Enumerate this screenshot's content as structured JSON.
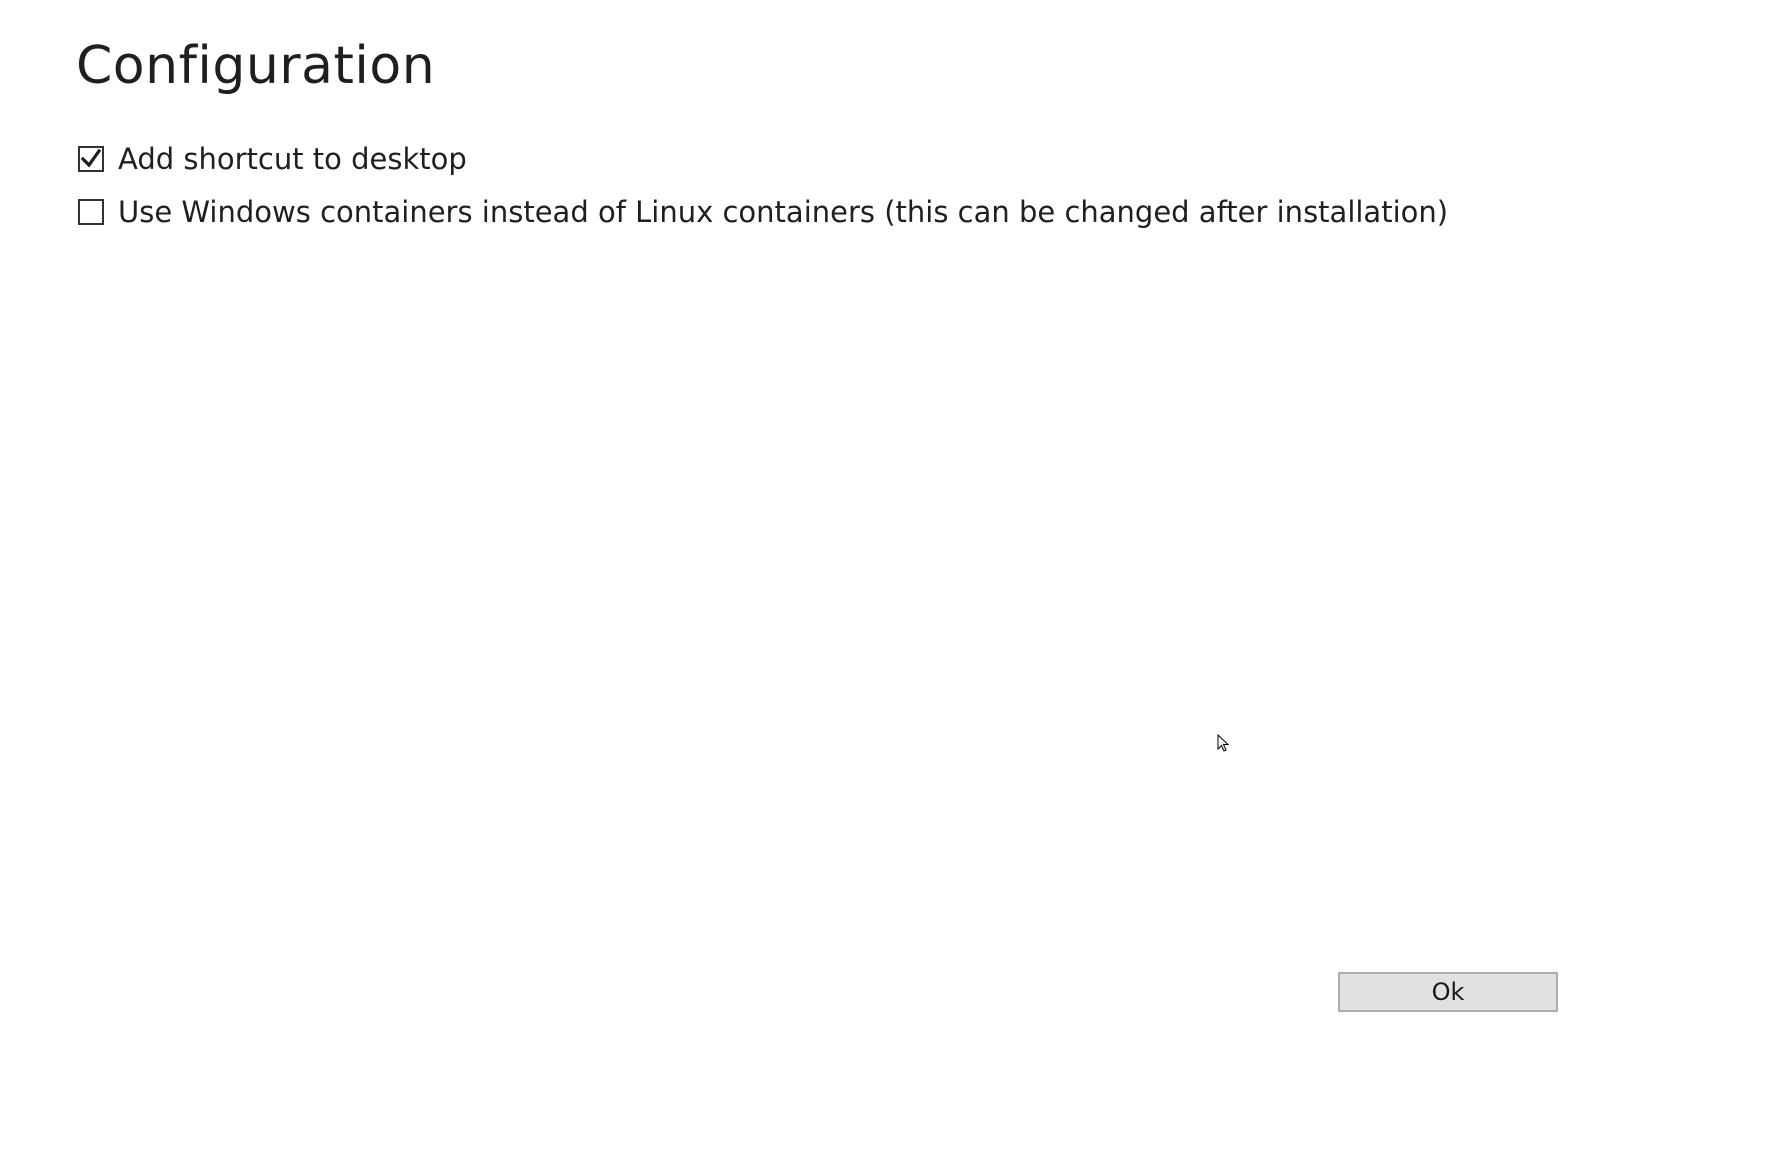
{
  "page": {
    "title": "Configuration"
  },
  "options": [
    {
      "label": "Add shortcut to desktop",
      "checked": true
    },
    {
      "label": "Use Windows containers instead of Linux containers (this can be changed after installation)",
      "checked": false
    }
  ],
  "buttons": {
    "ok_label": "Ok"
  },
  "icons": {
    "checkmark": "checkmark-icon",
    "cursor": "mouse-pointer-icon"
  },
  "colors": {
    "background": "#ffffff",
    "text": "#1f1f1f",
    "button_bg": "#e1e1e1",
    "button_border": "#adadad"
  }
}
